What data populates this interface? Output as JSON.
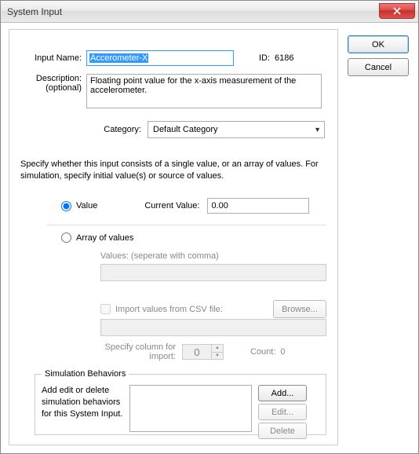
{
  "window": {
    "title": "System Input"
  },
  "buttons": {
    "ok": "OK",
    "cancel": "Cancel"
  },
  "form": {
    "inputNameLabel": "Input Name:",
    "inputName": "Accerometer-X",
    "idLabel": "ID:",
    "id": "6186",
    "descLabel1": "Description:",
    "descLabel2": "(optional)",
    "description": "Floating point value for the x-axis measurement of the accelerometer.",
    "categoryLabel": "Category:",
    "category": "Default Category"
  },
  "instructions": "Specify whether this input consists of a single value, or an array of values. For simulation, specify initial value(s) or source of values.",
  "value": {
    "radioLabel": "Value",
    "currentLabel": "Current Value:",
    "current": "0.00"
  },
  "array": {
    "radioLabel": "Array of values",
    "valuesLabel": "Values: (seperate with comma)",
    "values": "",
    "importLabel": "Import values from CSV file:",
    "browse": "Browse...",
    "importPath": "",
    "colLabel1": "Specify column for",
    "colLabel2": "import:",
    "col": "0",
    "countLabel": "Count:",
    "count": "0"
  },
  "sim": {
    "legend": "Simulation Behaviors",
    "help": "Add edit or delete simulation behaviors for this System Input.",
    "add": "Add...",
    "edit": "Edit...",
    "delete": "Delete"
  }
}
